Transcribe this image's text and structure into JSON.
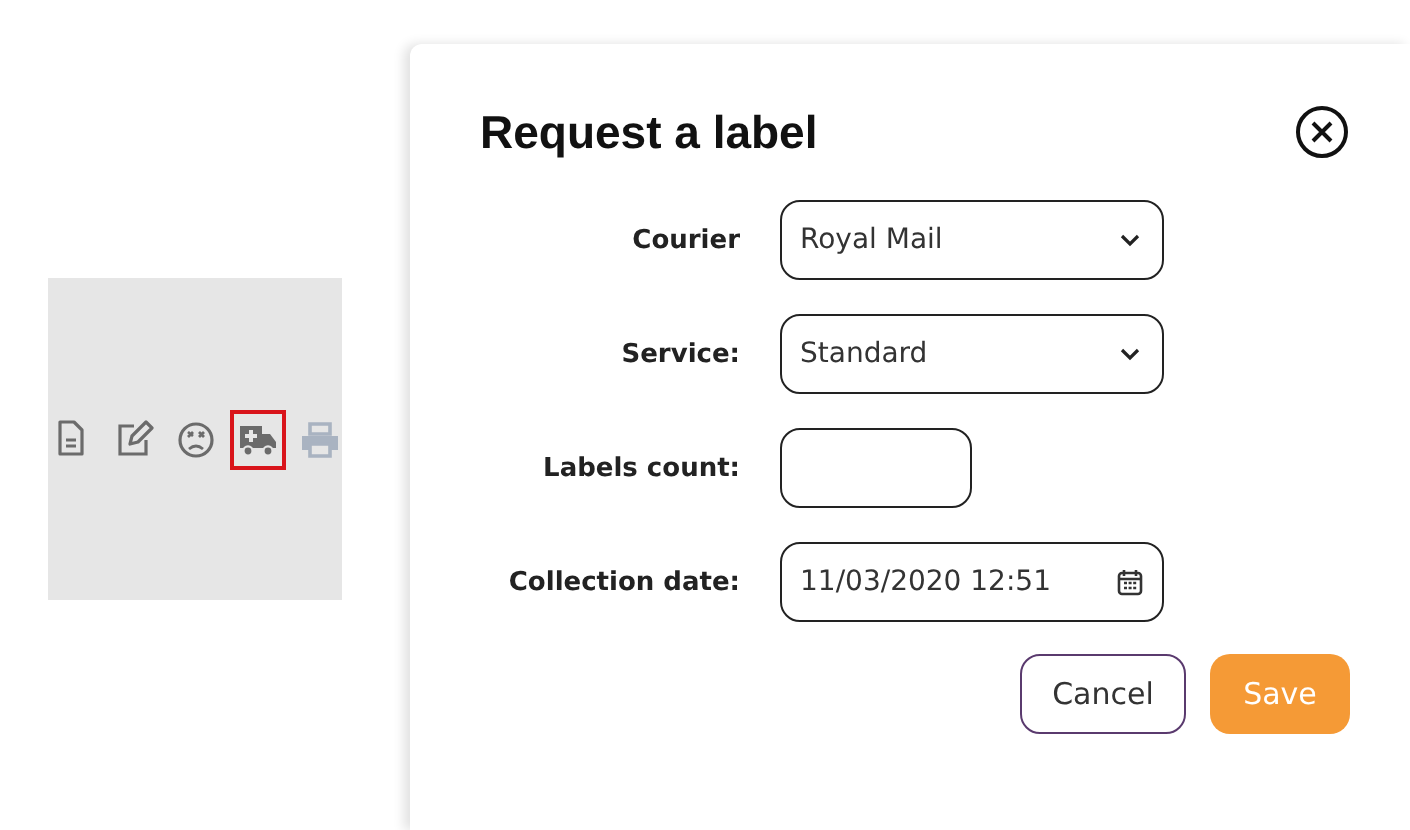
{
  "toolbar": {
    "actions": [
      {
        "kind": "document",
        "selected": false,
        "disabled": false
      },
      {
        "kind": "edit",
        "selected": false,
        "disabled": false
      },
      {
        "kind": "cancel",
        "selected": false,
        "disabled": false
      },
      {
        "kind": "truck",
        "selected": true,
        "disabled": false
      },
      {
        "kind": "printer",
        "selected": false,
        "disabled": true
      }
    ]
  },
  "dialog": {
    "title": "Request a label",
    "fields": [
      {
        "kind": "select",
        "label": "Courier",
        "value": "Royal Mail"
      },
      {
        "kind": "select",
        "label": "Service:",
        "value": "Standard"
      },
      {
        "kind": "number",
        "label": "Labels count:"
      },
      {
        "kind": "date",
        "label": "Collection date:",
        "value": "11/03/2020 12:51"
      }
    ],
    "buttons": [
      {
        "kind": "secondary",
        "label": "Cancel"
      },
      {
        "kind": "primary",
        "label": "Save"
      }
    ]
  }
}
